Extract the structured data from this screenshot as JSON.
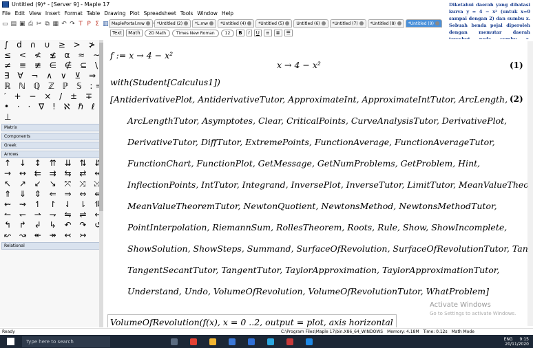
{
  "window": {
    "title": "Untitled (9)* - [Server 9] - Maple 17"
  },
  "menu": [
    "File",
    "Edit",
    "View",
    "Insert",
    "Format",
    "Table",
    "Drawing",
    "Plot",
    "Spreadsheet",
    "Tools",
    "Window",
    "Help"
  ],
  "toolbar_text": [
    "T",
    "P",
    "Σ"
  ],
  "note": "Diketahui daerah yang dibatasi kurva y = 4 − x² (untuk x=0 sampai dengan 2) dan sumbu x. Sebuah benda pejal diperoleh dengan memutar daerah tersebut pada sumbu x. Gambarlah benda pejal tersebut dan tentukan volumenya!",
  "tabs": [
    {
      "label": "MaplePortal.mw"
    },
    {
      "label": "*Untitled (2)"
    },
    {
      "label": "*L.mw"
    },
    {
      "label": "*Untitled (4)"
    },
    {
      "label": "*Untitled (5)"
    },
    {
      "label": "Untitled (6)"
    },
    {
      "label": "*Untitled (7)"
    },
    {
      "label": "*Untitled (8)"
    },
    {
      "label": "*Untitled (9)",
      "active": true
    }
  ],
  "format": {
    "text": "Text",
    "math": "Math",
    "style": "2D Math",
    "font": "Times New Roman",
    "size": "12",
    "bold": "B",
    "italic": "I",
    "underline": "U"
  },
  "palette": {
    "rows_top": [
      "∫ d ∩ ∪ ≥ > ≯ ≵",
      "≤ < ≮ ≴ α ≈ ∼ =",
      "≠ ≡ ≢ ∈ ∉ ⊆ \\ ∅",
      "∃ ∀ ¬ ∧ ∨ ⊻ ⇒ ℂ",
      "ℝ ℕ ℚ ℤ ℙ 𝕊 := ‖",
      "′ + − × / ± ∓ ∘",
      "• · · ∇ ! ℵ ℏ ℓ",
      "⊥"
    ],
    "sections": [
      "Matrix",
      "Components",
      "Greek",
      "Arrows",
      "Relational"
    ],
    "rows_arrows": [
      "↑ ↓ ↕ ⇈ ⇊ ⇅ ⇵ ←",
      "→ ↔ ⇇ ⇉ ⇆ ⇄ ↚ ↛",
      "↖ ↗ ↙ ↘ ⤧ ⤨ ⤩ ⤪",
      "⇑ ⇓ ⇕ ⇐ ⇒ ⇔ ⇚ ⇛",
      "⇜ ⇝ ↿ ↾ ⇃ ⇂ ⥮ ⥯",
      "↼ ↽ ⇀ ⇁ ⇋ ⇌ ↤ ↦",
      "↰ ↱ ↲ ↳ ↶ ↷ ↺ ↻",
      "↜ ↝ ↞ ↠ ↢ ↣"
    ]
  },
  "doc": {
    "line1": "f := x → 4 − x²",
    "out1": "x → 4 − x²",
    "eq1": "(1)",
    "line2": "with(Student[Calculus1])",
    "eq2": "(2)",
    "list": [
      "[AntiderivativePlot, AntiderivativeTutor, ApproximateInt, ApproximateIntTutor, ArcLength,",
      "ArcLengthTutor, Asymptotes, Clear, CriticalPoints, CurveAnalysisTutor, DerivativePlot,",
      "DerivativeTutor, DiffTutor, ExtremePoints, FunctionAverage, FunctionAverageTutor,",
      "FunctionChart, FunctionPlot, GetMessage, GetNumProblems, GetProblem, Hint,",
      "InflectionPoints, IntTutor, Integrand, InversePlot, InverseTutor, LimitTutor, MeanValueTheorem,",
      "MeanValueTheoremTutor, NewtonQuotient, NewtonsMethod, NewtonsMethodTutor,",
      "PointInterpolation, RiemannSum, RollesTheorem, Roots, Rule, Show, ShowIncomplete,",
      "ShowSolution, ShowSteps, Summand, SurfaceOfRevolution, SurfaceOfRevolutionTutor, Tangent,",
      "TangentSecantTutor, TangentTutor, TaylorApproximation, TaylorApproximationTutor,",
      "Understand, Undo, VolumeOfRevolution, VolumeOfRevolutionTutor, WhatProblem]"
    ],
    "line3": "VolumeOfRevolution(f(x), x = 0 ..2, output = plot, axis horizontal"
  },
  "watermark": {
    "title": "Activate Windows",
    "sub": "Go to Settings to activate Windows."
  },
  "status": {
    "ready": "Ready",
    "path": "C:\\Program Files\\Maple 17\\bin.X86_64_WINDOWS",
    "memory": "Memory: 4.18M",
    "time": "Time: 0.12s",
    "mode": "Math Mode"
  },
  "taskbar": {
    "search": "Type here to search",
    "lang": "ENG",
    "clock": "9:15",
    "date": "20/11/2020"
  }
}
